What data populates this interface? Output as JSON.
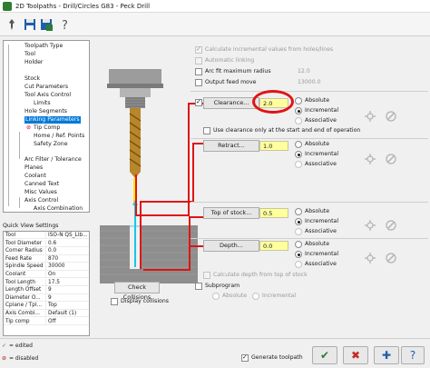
{
  "window": {
    "title": "2D Toolpaths - Drill/Circles G83 - Peck Drill"
  },
  "toolbar": {
    "buttons": [
      "pin-icon",
      "save-icon",
      "save-as-icon",
      "question-icon"
    ]
  },
  "tree": {
    "items": [
      {
        "label": "Toolpath Type"
      },
      {
        "label": "Tool"
      },
      {
        "label": "Holder"
      },
      {
        "label": "Stock"
      },
      {
        "label": "Cut Parameters"
      },
      {
        "label": "Tool Axis Control"
      },
      {
        "label": "Limits"
      },
      {
        "label": "Hole Segments"
      },
      {
        "label": "Linking Parameters"
      },
      {
        "label": "Tip Comp"
      },
      {
        "label": "Home / Ref. Points"
      },
      {
        "label": "Safety Zone"
      },
      {
        "label": "Arc Filter / Tolerance"
      },
      {
        "label": "Planes"
      },
      {
        "label": "Coolant"
      },
      {
        "label": "Canned Text"
      },
      {
        "label": "Misc Values"
      },
      {
        "label": "Axis Control"
      },
      {
        "label": "Axis Combination"
      }
    ]
  },
  "quick_view": {
    "title": "Quick View Settings",
    "rows": [
      {
        "k": "Tool",
        "v": "ISO-N QS_Lib..."
      },
      {
        "k": "Tool Diameter",
        "v": "0.6"
      },
      {
        "k": "Corner Radius",
        "v": "0.0"
      },
      {
        "k": "Feed Rate",
        "v": "870"
      },
      {
        "k": "Spindle Speed",
        "v": "30000"
      },
      {
        "k": "Coolant",
        "v": "On"
      },
      {
        "k": "Tool Length",
        "v": "17.5"
      },
      {
        "k": "Length Offset",
        "v": "9"
      },
      {
        "k": "Diameter O...",
        "v": "9"
      },
      {
        "k": "Cplane / Tpl...",
        "v": "Top"
      },
      {
        "k": "Axis Combi...",
        "v": "Default (1)"
      },
      {
        "k": "Tip comp",
        "v": "Off"
      }
    ]
  },
  "legend": {
    "edited": "= edited",
    "disabled": "= disabled"
  },
  "options": {
    "calc_incremental": "Calculate incremental values from holes/lines",
    "automatic_linking": "Automatic linking",
    "arc_fit": "Arc fit maximum radius",
    "arc_fit_value": "12.0",
    "output_feed": "Output feed move",
    "output_feed_value": "13000.0"
  },
  "clearance": {
    "button": "Clearance...",
    "value": "2.0",
    "absolute": "Absolute",
    "incremental": "Incremental",
    "associative": "Associative",
    "use_clearance": "Use clearance only at the start and end of operation"
  },
  "retract": {
    "button": "Retract...",
    "value": "1.0",
    "absolute": "Absolute",
    "incremental": "Incremental",
    "associative": "Associative"
  },
  "top_of_stock": {
    "button": "Top of stock...",
    "value": "0.5",
    "absolute": "Absolute",
    "incremental": "Incremental",
    "associative": "Associative"
  },
  "depth": {
    "button": "Depth...",
    "value": "0.0",
    "absolute": "Absolute",
    "incremental": "Incremental",
    "associative": "Associative",
    "calc_depth": "Calculate depth from top of stock"
  },
  "subprogram": {
    "label": "Subprogram",
    "absolute": "Absolute",
    "incremental": "Incremental"
  },
  "collisions": {
    "check_button": "Check Collisions",
    "display": "Display collisions"
  },
  "footer": {
    "generate": "Generate toolpath"
  },
  "colors": {
    "accent": "#0078d7",
    "highlight": "#e01414",
    "value_bg": "#ffff9e"
  }
}
